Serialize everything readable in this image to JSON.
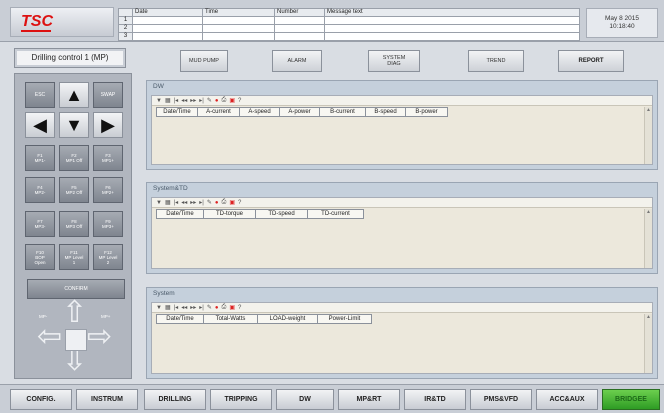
{
  "header": {
    "logo_text": "TSC",
    "msg_headers": [
      "Date",
      "Time",
      "Number",
      "Message text"
    ],
    "msg_rows": [
      "1",
      "2",
      "3"
    ],
    "date": "May  8   2015",
    "time": "10:18:40"
  },
  "left": {
    "title": "Drilling control 1 (MP)",
    "keys": {
      "esc": "ESC",
      "swap": "SWAP",
      "f1": "F1\nMP1-",
      "f2": "F2\nMP1 Off",
      "f3": "F3\nMP1+",
      "f4": "F4\nMP2-",
      "f5": "F5\nMP2 Off",
      "f6": "F6\nMP2+",
      "f7": "F7\nMP3-",
      "f8": "F8\nMP3 Off",
      "f9": "F9\nMP3+",
      "f10": "F10\nBOP\nOpen",
      "f11": "F11\nMP Level\n1",
      "f12": "F12\nMP Level\n2"
    },
    "confirm": "CONFIRM",
    "dpad_left": "MP-",
    "dpad_right": "MP+"
  },
  "top_nav": [
    "MUD PUMP",
    "ALARM",
    "SYSTEM\nDIAG",
    "TREND",
    "REPORT"
  ],
  "panels": [
    {
      "title": "DW",
      "columns": [
        "Date/Time",
        "A-current",
        "A-speed",
        "A-power",
        "B-current",
        "B-speed",
        "B-power"
      ]
    },
    {
      "title": "System&TD",
      "columns": [
        "Date/Time",
        "TD-torque",
        "TD-speed",
        "TD-current"
      ]
    },
    {
      "title": "System",
      "columns": [
        "Date/Time",
        "Total-Watts",
        "LOAD-weight",
        "Power-Limit"
      ]
    }
  ],
  "bottom_nav": [
    "CONFIG.",
    "INSTRUM",
    "DRILLING",
    "TRIPPING",
    "DW",
    "MP&RT",
    "IR&TD",
    "PMS&VFD",
    "ACC&AUX",
    "BRIDGEE"
  ],
  "colors": {
    "active": "#3aa82d",
    "logo": "#dd1111"
  }
}
